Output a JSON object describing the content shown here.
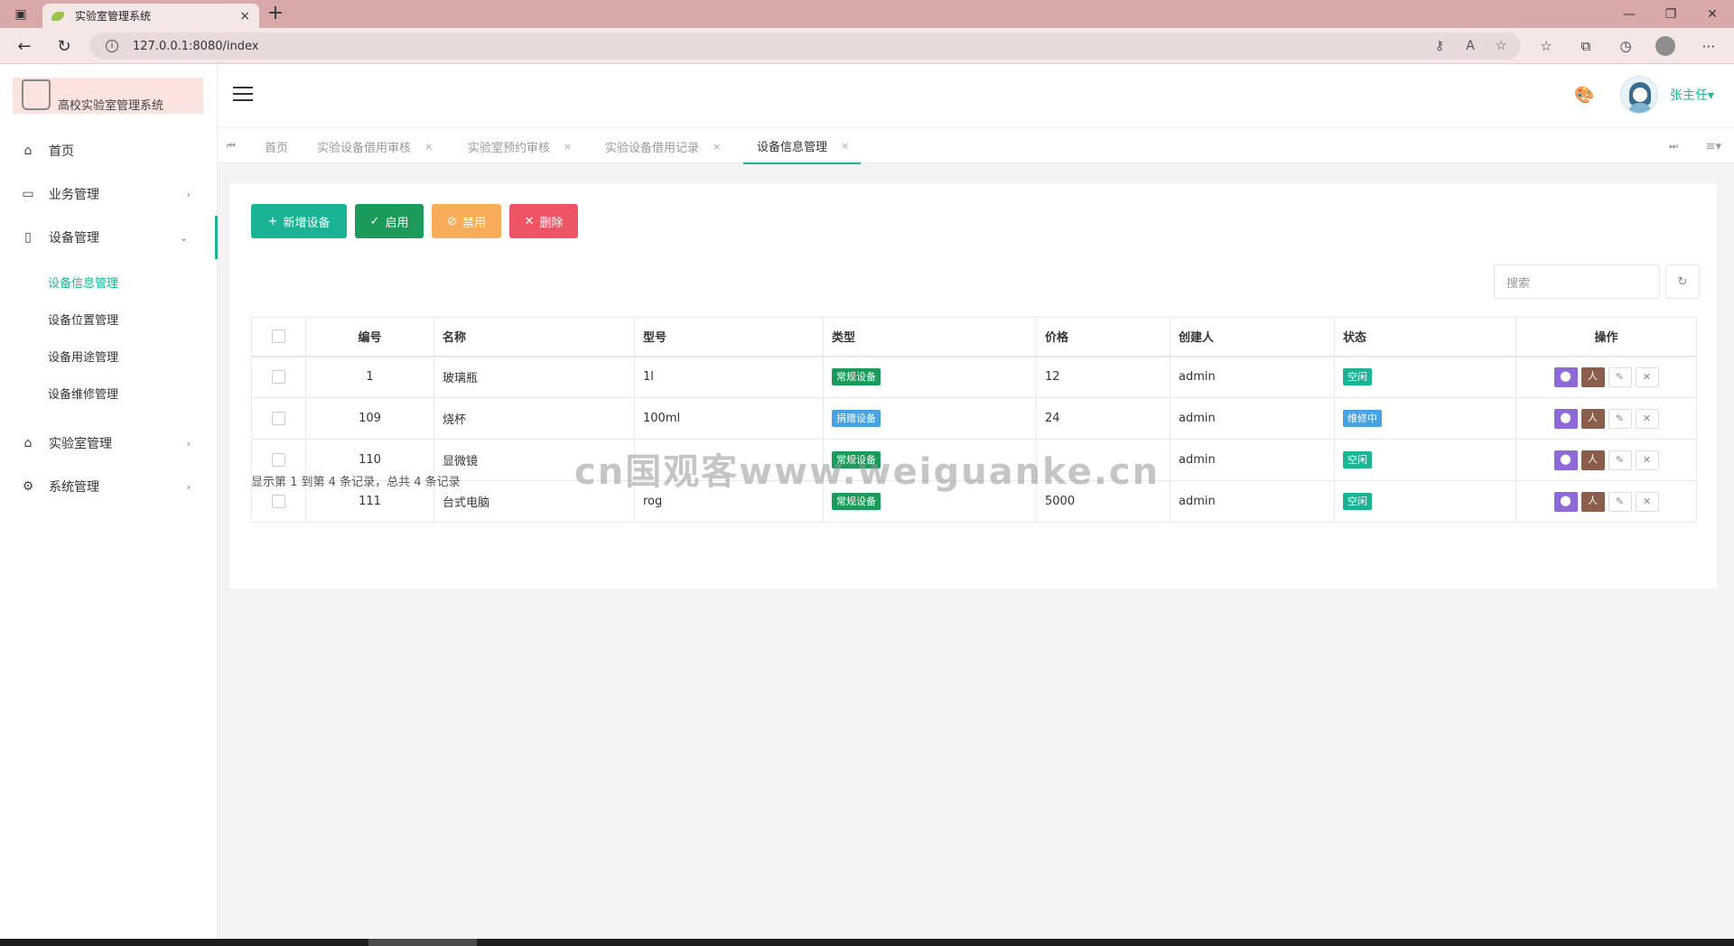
{
  "browser": {
    "tab_title": "实验室管理系统",
    "tab_close": "×",
    "new_tab": "+",
    "url": "127.0.0.1:8080/index",
    "info_glyph": "i",
    "window_controls": [
      "—",
      "❐",
      "✕"
    ]
  },
  "sidebar": {
    "logo_text": "高校实验室管理系统",
    "items": [
      {
        "label": "首页",
        "icon": "home-icon",
        "glyph": "⌂"
      },
      {
        "label": "业务管理",
        "icon": "laptop-icon",
        "glyph": "▭",
        "chevron": "›"
      },
      {
        "label": "设备管理",
        "icon": "book-icon",
        "glyph": "▯",
        "chevron": "⌄"
      },
      {
        "label": "实验室管理",
        "icon": "institution-icon",
        "glyph": "⌂",
        "chevron": "›"
      },
      {
        "label": "系统管理",
        "icon": "gear-icon",
        "glyph": "⚙",
        "chevron": "›"
      }
    ],
    "sub_items": [
      "设备信息管理",
      "设备位置管理",
      "设备用途管理",
      "设备维修管理"
    ]
  },
  "header": {
    "username": "张主任▾",
    "palette_glyph": "🎨"
  },
  "page_tabs": {
    "first_glyph": "⏮",
    "last_glyph": "⏭",
    "menu_glyph": "≡▾",
    "close_glyph": "×",
    "tabs": [
      "首页",
      "实验设备借用审核",
      "实验室预约审核",
      "实验设备借用记录",
      "设备信息管理"
    ]
  },
  "toolbar": {
    "add_label": "新增设备",
    "add_glyph": "+",
    "enable_label": "启用",
    "enable_glyph": "✓",
    "disable_label": "禁用",
    "disable_glyph": "⊘",
    "delete_label": "删除",
    "delete_glyph": "✕"
  },
  "search": {
    "placeholder": "搜索",
    "refresh_glyph": "↻"
  },
  "table": {
    "columns": [
      "编号",
      "名称",
      "型号",
      "类型",
      "价格",
      "创建人",
      "状态",
      "操作"
    ],
    "rows": [
      {
        "id": "1",
        "name": "玻璃瓶",
        "model": "1l",
        "type": "常规设备",
        "price": "12",
        "creator": "admin",
        "status": "空闲"
      },
      {
        "id": "109",
        "name": "烧杯",
        "model": "100ml",
        "type": "捐赠设备",
        "price": "24",
        "creator": "admin",
        "status": "维修中"
      },
      {
        "id": "110",
        "name": "显微镜",
        "model": "",
        "type": "常规设备",
        "price": "",
        "creator": "admin",
        "status": "空闲"
      },
      {
        "id": "111",
        "name": "台式电脑",
        "model": "rog",
        "type": "常规设备",
        "price": "5000",
        "creator": "admin",
        "status": "空闲"
      }
    ],
    "action_glyphs": {
      "location": "⬤",
      "person": "人",
      "edit": "✎",
      "delete": "✕"
    }
  },
  "pagination": {
    "summary": "显示第 1 到第 4 条记录，总共 4 条记录"
  },
  "watermark": "cn国观客www.weiguanke.cn",
  "colors": {
    "primary": "#1ab394",
    "success": "#1c9a5a",
    "warning": "#f8ac59",
    "danger": "#ed5565",
    "info": "#23c6c8",
    "badge_regular": "#1c9a5a",
    "badge_donated": "#4aa3df",
    "badge_idle": "#1ab394",
    "badge_repair": "#4aa3df"
  }
}
